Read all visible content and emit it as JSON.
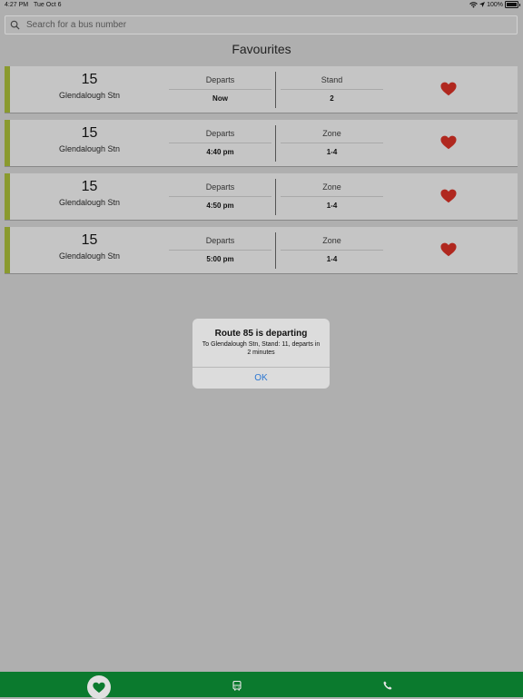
{
  "status_bar": {
    "time": "4:27 PM",
    "date": "Tue Oct 6",
    "battery": "100%"
  },
  "search": {
    "placeholder": "Search for a bus number"
  },
  "page_title": "Favourites",
  "favourites": [
    {
      "route": "15",
      "stop": "Glendalough Stn",
      "departs_label": "Departs",
      "departs_value": "Now",
      "info_label": "Stand",
      "info_value": "2"
    },
    {
      "route": "15",
      "stop": "Glendalough Stn",
      "departs_label": "Departs",
      "departs_value": "4:40 pm",
      "info_label": "Zone",
      "info_value": "1-4"
    },
    {
      "route": "15",
      "stop": "Glendalough Stn",
      "departs_label": "Departs",
      "departs_value": "4:50 pm",
      "info_label": "Zone",
      "info_value": "1-4"
    },
    {
      "route": "15",
      "stop": "Glendalough Stn",
      "departs_label": "Departs",
      "departs_value": "5:00 pm",
      "info_label": "Zone",
      "info_value": "1-4"
    }
  ],
  "alert": {
    "title": "Route 85 is departing",
    "message": "To Glendalough Stn, Stand: 11, departs in 2 minutes",
    "ok_label": "OK"
  },
  "tabbar": {
    "items": [
      "heart-icon",
      "bus-icon",
      "phone-icon"
    ],
    "active": "heart-icon"
  },
  "colors": {
    "accent": "#8a9a2e",
    "heart": "#b0281f",
    "tabbar": "#0b7a2e",
    "link": "#2a76d2"
  }
}
